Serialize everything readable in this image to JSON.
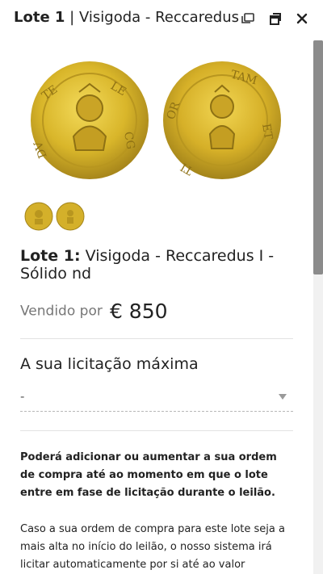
{
  "header": {
    "lot_label": "Lote 1",
    "separator": " | ",
    "title": "Visigoda - Reccaredus"
  },
  "icons": {
    "gallery": "gallery-icon",
    "popout": "popout-window-icon",
    "close": "close-icon"
  },
  "lot": {
    "label": "Lote 1:",
    "title": "Visigoda - Reccaredus I - Sólido nd"
  },
  "sale": {
    "sold_label": "Vendido por",
    "price": "€ 850"
  },
  "bid": {
    "label": "A sua licitação máxima",
    "selected": "-"
  },
  "info": {
    "bold_text": "Poderá adicionar ou aumentar a sua ordem de compra até ao momento em que o lote entre em fase de licitação durante o leilão.",
    "normal_text": "Caso a sua ordem de compra para este lote seja a mais alta no início do leilão, o nosso sistema irá licitar automaticamente por si até ao valor máximo"
  },
  "colors": {
    "coin_gold": "#d9b62a",
    "coin_dark": "#a8871b",
    "scroll_thumb": "#8b8b8b"
  }
}
